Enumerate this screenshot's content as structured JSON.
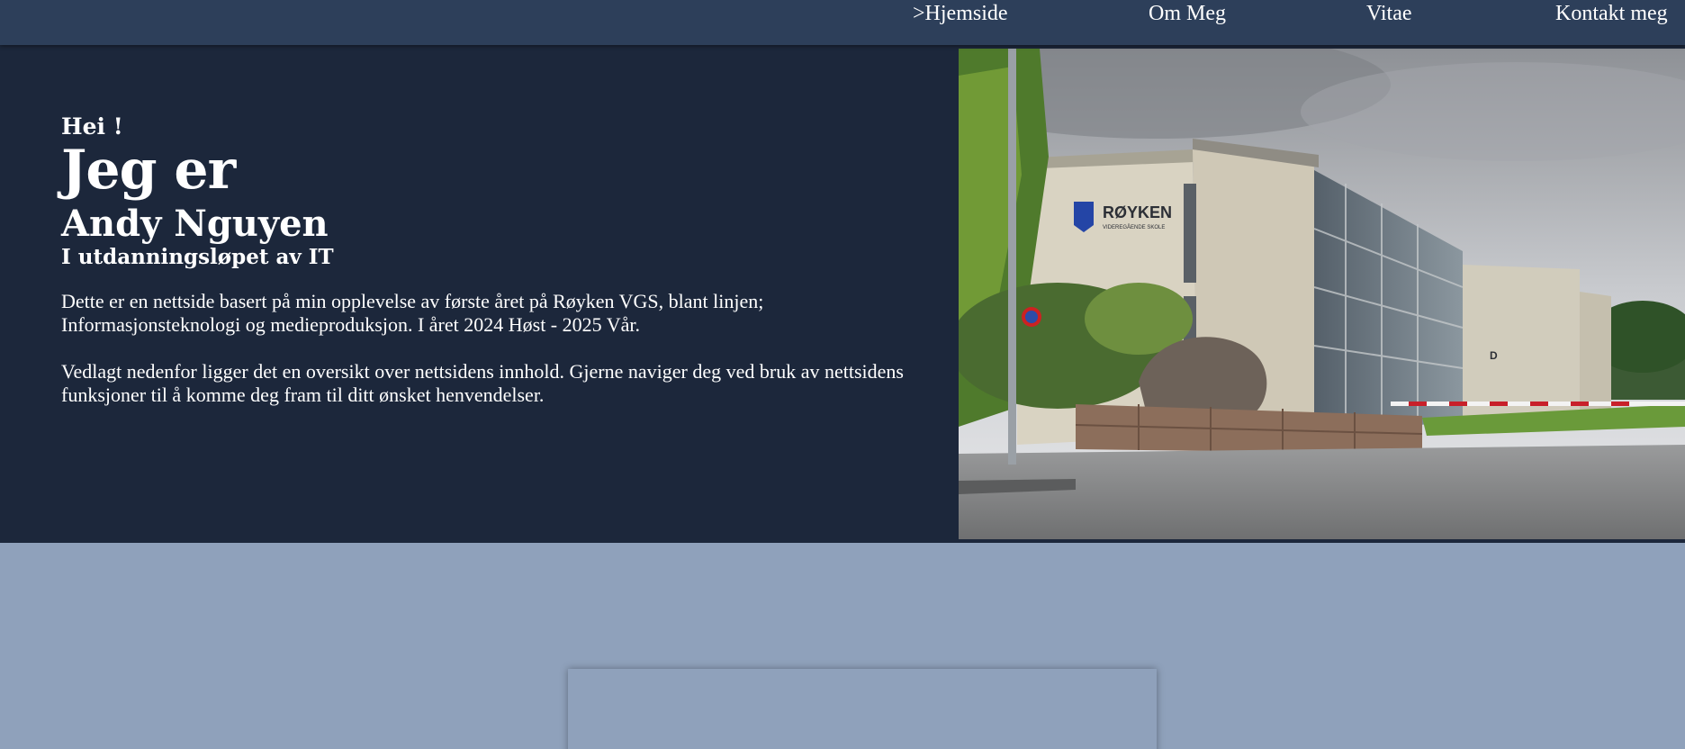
{
  "nav": {
    "items": [
      {
        "label": ">Hjemside"
      },
      {
        "label": "Om Meg"
      },
      {
        "label": "Vitae"
      },
      {
        "label": "Kontakt meg"
      }
    ]
  },
  "hero": {
    "greeting": "Hei !",
    "intro": "Jeg er",
    "name": "Andy Nguyen",
    "subtitle": "I utdanningsløpet av IT",
    "paragraphs": [
      "Dette er en nettside basert på min opplevelse av første året på Røyken VGS, blant linjen; Informasjonsteknologi og medieproduksjon. I året 2024 Høst - 2025 Vår.",
      "Vedlagt nedenfor ligger det en oversikt over nettsidens innhold. Gjerne naviger deg ved bruk av nettsidens funksjoner til å komme deg fram til ditt ønsket henvendelser."
    ],
    "image": {
      "sign_text": "RØYKEN",
      "sign_subtext": "VIDEREGÅENDE SKOLE",
      "wing_letter": "D"
    }
  },
  "colors": {
    "nav_bg": "#2d3f5a",
    "hero_bg": "#1c273b",
    "page_bg": "#8fa1bb",
    "text": "#ffffff"
  }
}
